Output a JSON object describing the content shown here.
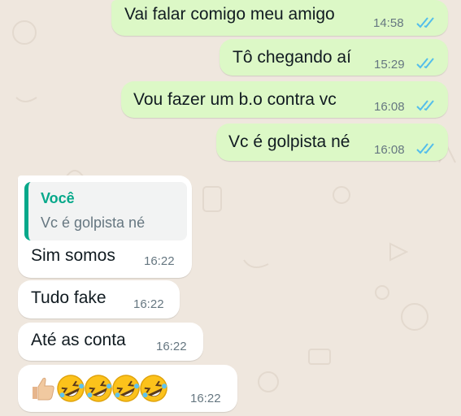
{
  "accent": "#06a88a",
  "tick_color": "#53bdeb",
  "outgoing_bubble_color": "#dcf8c6",
  "incoming_bubble_color": "#ffffff",
  "outgoing": [
    {
      "text": "Vai falar comigo meu amigo",
      "time": "14:58",
      "status": "read"
    },
    {
      "text": "Tô chegando aí",
      "time": "15:29",
      "status": "read"
    },
    {
      "text": "Vou fazer um b.o contra vc",
      "time": "16:08",
      "status": "read"
    },
    {
      "text": "Vc é golpista né",
      "time": "16:08",
      "status": "read"
    }
  ],
  "incoming": [
    {
      "reply": {
        "author": "Você",
        "text": "Vc é golpista né"
      },
      "text": "Sim somos",
      "time": "16:22"
    },
    {
      "text": "Tudo fake",
      "time": "16:22"
    },
    {
      "text": "Até as conta",
      "time": "16:22"
    },
    {
      "emojis": [
        "thumbs-up-emoji",
        "rolling-on-the-floor-laughing-emoji",
        "rolling-on-the-floor-laughing-emoji",
        "rolling-on-the-floor-laughing-emoji",
        "rolling-on-the-floor-laughing-emoji"
      ],
      "time": "16:22"
    }
  ]
}
